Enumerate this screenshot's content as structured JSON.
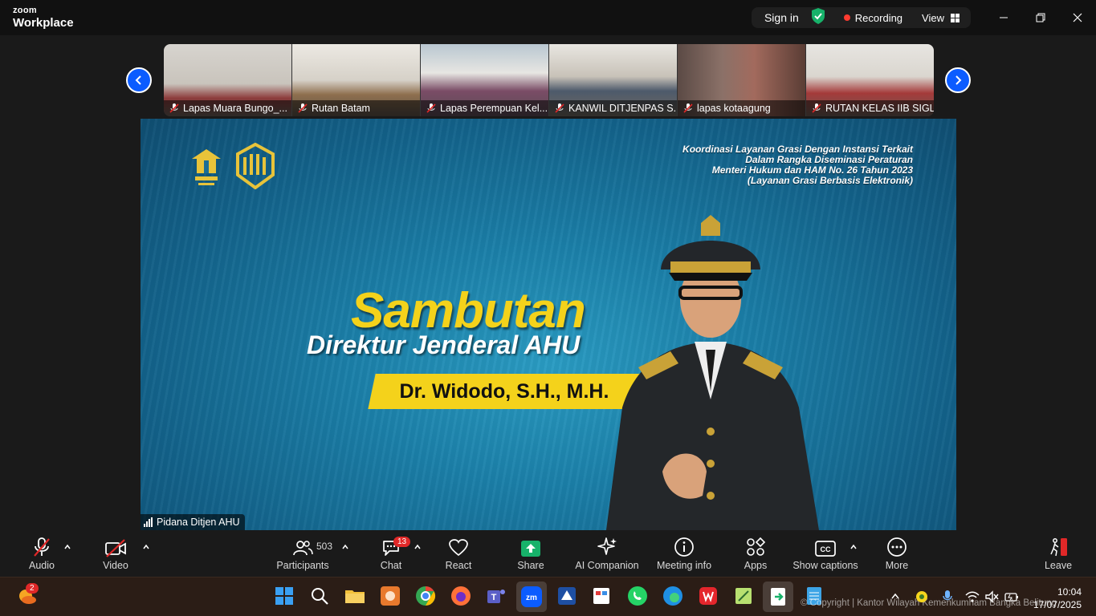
{
  "app": {
    "brand_top": "zoom",
    "brand_bottom": "Workplace"
  },
  "titlebar": {
    "sign_in": "Sign in",
    "recording": "Recording",
    "view": "View"
  },
  "thumbnails": [
    {
      "label": "Lapas Muara Bungo_..."
    },
    {
      "label": "Rutan Batam"
    },
    {
      "label": "Lapas Perempuan Kel..."
    },
    {
      "label": "KANWIL DITJENPAS S..."
    },
    {
      "label": "lapas kotaagung"
    },
    {
      "label": "RUTAN KELAS IIB SIGLI"
    }
  ],
  "slide": {
    "top_right_lines": [
      "Koordinasi Layanan Grasi Dengan Instansi Terkait",
      "Dalam Rangka Diseminasi Peraturan",
      "Menteri Hukum dan HAM No. 26 Tahun 2023",
      "(Layanan Grasi Berbasis Elektronik)"
    ],
    "heading": "Sambutan",
    "subheading": "Direktur Jenderal AHU",
    "name": "Dr. Widodo, S.H., M.H."
  },
  "speaker_label": "Pidana Ditjen AHU",
  "toolbar": {
    "audio": "Audio",
    "video": "Video",
    "participants": "Participants",
    "participants_count": "503",
    "chat": "Chat",
    "chat_badge": "13",
    "react": "React",
    "share": "Share",
    "ai_companion": "AI Companion",
    "meeting_info": "Meeting info",
    "apps": "Apps",
    "show_captions": "Show captions",
    "more": "More",
    "leave": "Leave"
  },
  "taskbar": {
    "weather_badge": "2",
    "copyright": "© Copyright | Kantor Wilayah Kemenkumham Bangka Belitung",
    "time": "10:04",
    "date": "17/07/2025"
  },
  "colors": {
    "accent": "#0b5cff",
    "share_green": "#17b26a",
    "slide_yellow": "#f4d21b",
    "record_red": "#ff3b30"
  }
}
